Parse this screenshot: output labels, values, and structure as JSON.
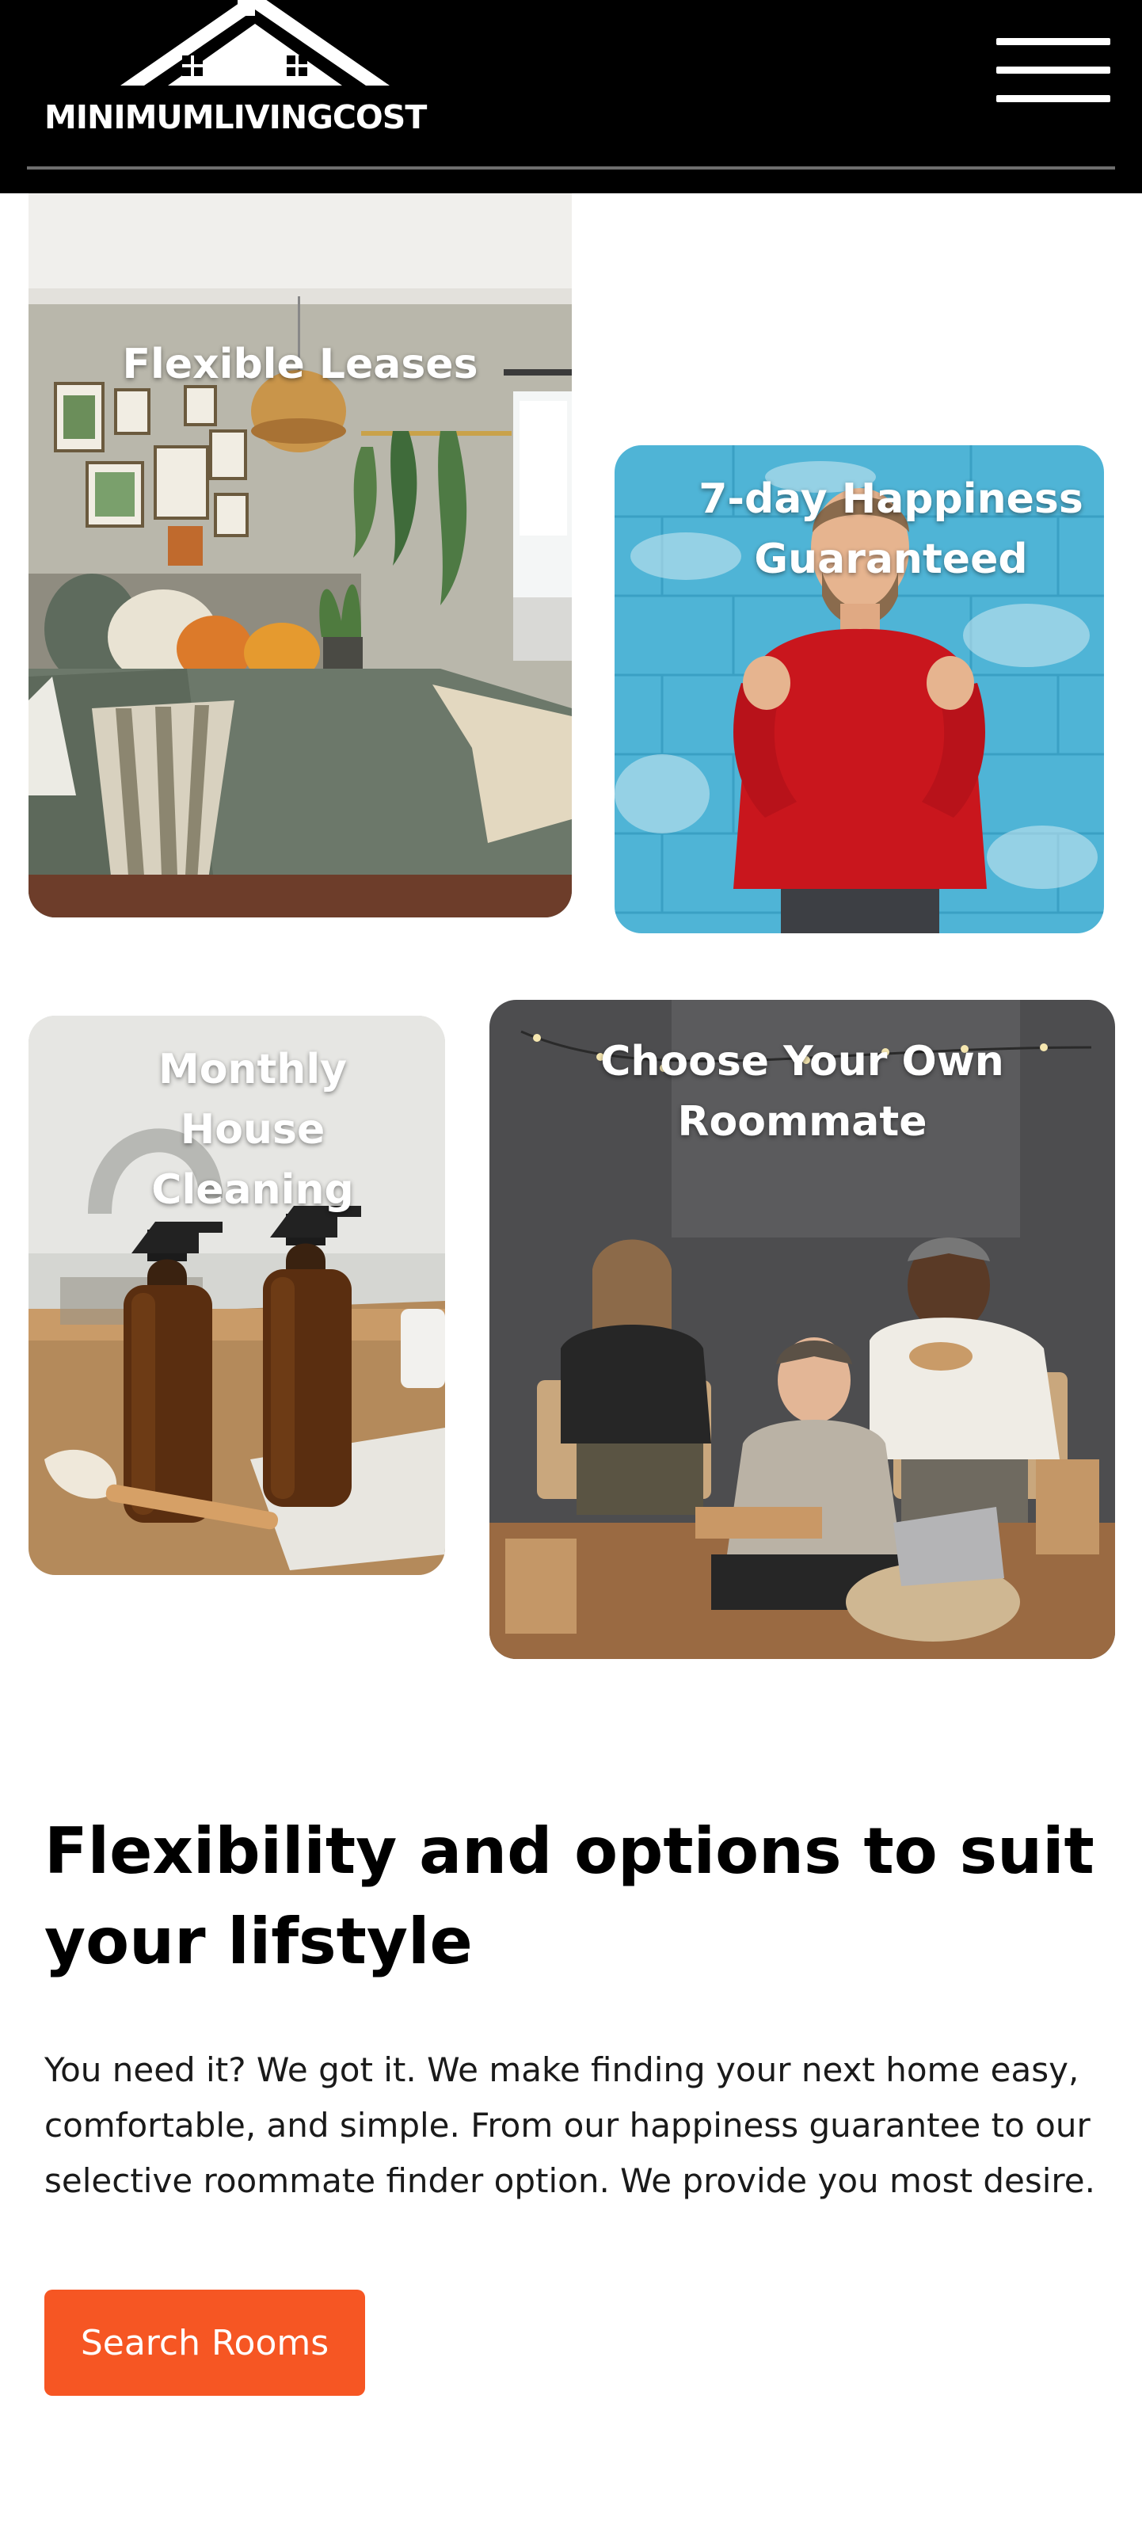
{
  "header": {
    "logo_text": "MINIMUMLIVINGCOST",
    "menu_icon": "hamburger-menu-icon",
    "background_color": "#000000"
  },
  "features": [
    {
      "title": "Flexible Leases",
      "image": "bedroom-photo"
    },
    {
      "title": "7-day Happiness Guaranteed",
      "image": "happy-man-photo"
    },
    {
      "title": "Monthly House Cleaning",
      "image": "cleaning-bottles-photo"
    },
    {
      "title": "Choose Your Own Roommate",
      "image": "roommates-photo"
    }
  ],
  "content": {
    "heading": "Flexibility and options to suit your lifstyle",
    "body": "You need it? We got it. We make finding your next home easy, comfortable, and simple. From our happiness guarantee to our selective roommate finder option. We provide you most desire.",
    "cta_label": "Search Rooms"
  },
  "colors": {
    "accent": "#f65623",
    "text": "#000000",
    "card_title": "#ffffff"
  }
}
